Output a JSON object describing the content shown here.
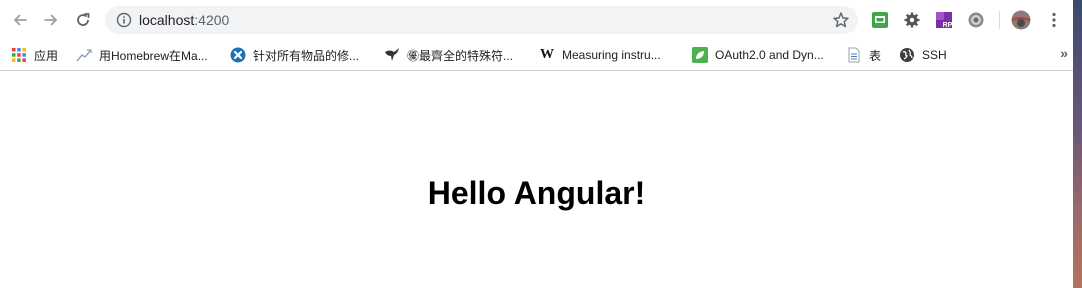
{
  "browser": {
    "address_bar": {
      "host": "localhost",
      "port": ":4200"
    },
    "icons": {
      "back": "back-arrow-icon",
      "forward": "forward-arrow-icon",
      "reload": "reload-icon",
      "site_info": "info-icon",
      "bookmark_star": "star-icon",
      "menu": "kebab-menu-icon"
    },
    "extensions": [
      {
        "name": "green-extension-icon"
      },
      {
        "name": "gear-extension-icon"
      },
      {
        "name": "rp-extension-icon",
        "label": "RP"
      },
      {
        "name": "cog-extension-icon"
      },
      {
        "name": "profile-avatar-icon"
      }
    ]
  },
  "bookmarks": [
    {
      "icon": "apps-grid-icon",
      "label": "应用"
    },
    {
      "icon": "homebrew-icon",
      "label": "用Homebrew在Ma..."
    },
    {
      "icon": "blue-x-icon",
      "label": "针对所有物品的修..."
    },
    {
      "icon": "bird-icon",
      "label": "㊝最齊全的特殊符..."
    },
    {
      "icon": "wikipedia-icon",
      "label": "Measuring instru..."
    },
    {
      "icon": "green-leaf-icon",
      "label": "OAuth2.0 and Dyn..."
    },
    {
      "icon": "doc-icon",
      "label": "表"
    },
    {
      "icon": "globe-icon",
      "label": "SSH"
    }
  ],
  "bookmarks_overflow": "»",
  "page": {
    "heading": "Hello Angular!"
  }
}
